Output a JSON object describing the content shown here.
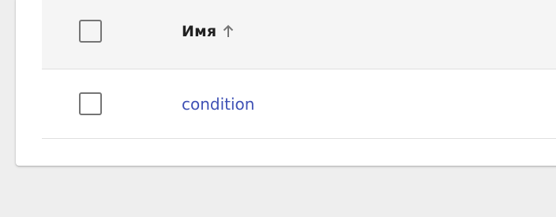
{
  "table": {
    "header": {
      "name_label": "Имя",
      "sort_icon": "arrow-up-icon",
      "select_all_checked": false
    },
    "rows": [
      {
        "name": "condition",
        "checked": false
      }
    ]
  },
  "colors": {
    "link": "#3f51b5",
    "header_bg": "#f5f5f5",
    "page_bg": "#eeeeee",
    "checkbox_border": "#757575"
  }
}
